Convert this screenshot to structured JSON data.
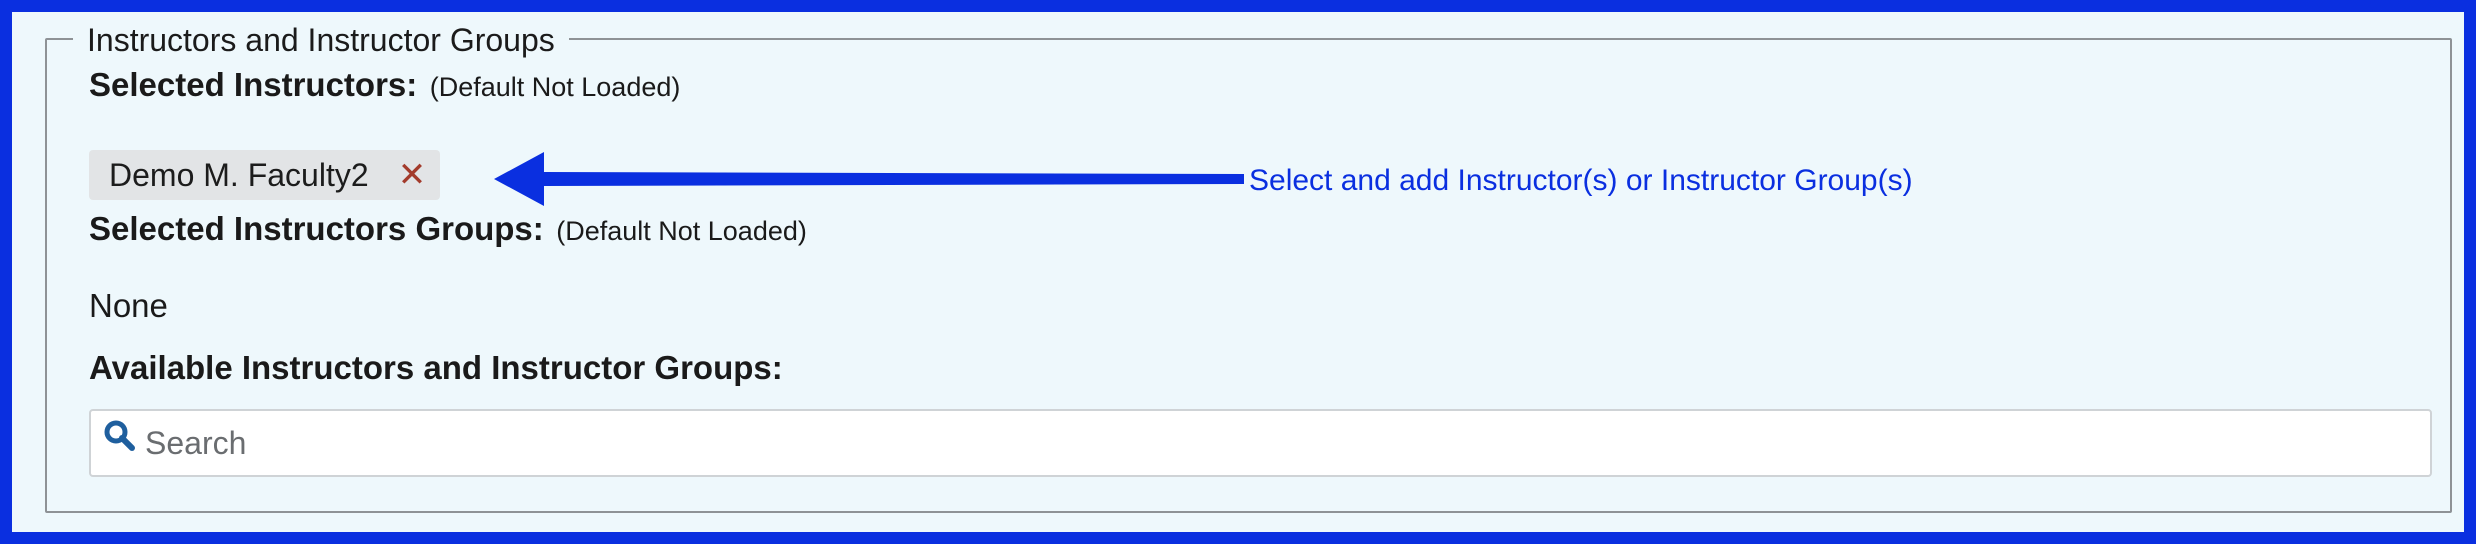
{
  "fieldset": {
    "legend": "Instructors and Instructor Groups"
  },
  "selected_instructors": {
    "label": "Selected Instructors:",
    "note": "(Default Not Loaded)",
    "chips": [
      {
        "name": "Demo M. Faculty2",
        "remove_glyph": "✕",
        "remove_icon": "close-icon"
      }
    ]
  },
  "selected_groups": {
    "label": "Selected Instructors Groups:",
    "note": "(Default Not Loaded)",
    "empty_text": "None"
  },
  "available": {
    "label": "Available Instructors and Instructor Groups:",
    "search_placeholder": "Search",
    "search_value": "",
    "search_icon": "search-icon"
  },
  "annotation": {
    "text": "Select and add Instructor(s) or Instructor Group(s)",
    "color": "#0a2fe0"
  },
  "colors": {
    "frame_border": "#0a2fe0",
    "panel_background": "#eef8fc",
    "chip_background": "#e2e4e6",
    "remove_icon": "#a33b2c",
    "search_icon": "#1f5f9e"
  }
}
